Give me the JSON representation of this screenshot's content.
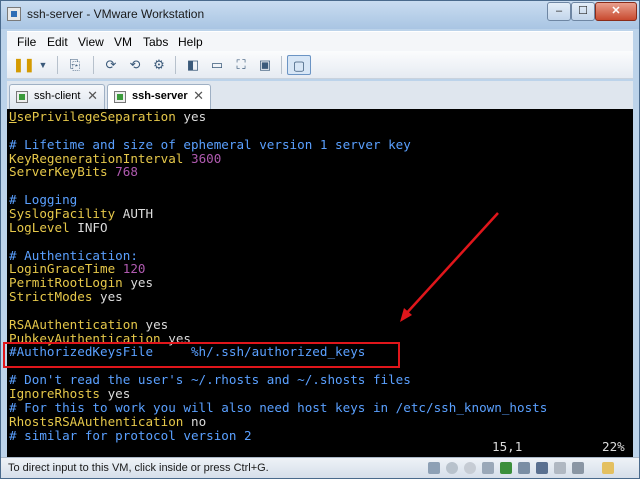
{
  "window": {
    "title": "ssh-server - VMware Workstation",
    "minimize": "–",
    "maximize": "☐",
    "close": "✕"
  },
  "menu": [
    "File",
    "Edit",
    "View",
    "VM",
    "Tabs",
    "Help"
  ],
  "tabs": [
    {
      "label": "ssh-client",
      "active": false
    },
    {
      "label": "ssh-server",
      "active": true
    }
  ],
  "console": {
    "lines": [
      [
        {
          "t": "U",
          "c": "cursor-u"
        },
        {
          "t": "sePrivilegeSeparation ",
          "c": "kw"
        },
        {
          "t": "yes",
          "c": "val"
        }
      ],
      [],
      [
        {
          "t": "# Lifetime and size of ephemeral version 1 server key",
          "c": "cmt"
        }
      ],
      [
        {
          "t": "KeyRegenerationInterval ",
          "c": "kw"
        },
        {
          "t": "3600",
          "c": "num"
        }
      ],
      [
        {
          "t": "ServerKeyBits ",
          "c": "kw"
        },
        {
          "t": "768",
          "c": "num"
        }
      ],
      [],
      [
        {
          "t": "# Logging",
          "c": "cmt"
        }
      ],
      [
        {
          "t": "SyslogFacility ",
          "c": "kw"
        },
        {
          "t": "AUTH",
          "c": "val"
        }
      ],
      [
        {
          "t": "LogLevel ",
          "c": "kw"
        },
        {
          "t": "INFO",
          "c": "val"
        }
      ],
      [],
      [
        {
          "t": "# Authentication:",
          "c": "cmt"
        }
      ],
      [
        {
          "t": "LoginGraceTime ",
          "c": "kw"
        },
        {
          "t": "120",
          "c": "num"
        }
      ],
      [
        {
          "t": "PermitRootLogin ",
          "c": "kw"
        },
        {
          "t": "yes",
          "c": "val"
        }
      ],
      [
        {
          "t": "StrictModes ",
          "c": "kw"
        },
        {
          "t": "yes",
          "c": "val"
        }
      ],
      [],
      [
        {
          "t": "RSAAuthentication ",
          "c": "kw"
        },
        {
          "t": "yes",
          "c": "val"
        }
      ],
      [
        {
          "t": "PubkeyAuthentication ",
          "c": "kw"
        },
        {
          "t": "yes",
          "c": "val"
        }
      ],
      [
        {
          "t": "#AuthorizedKeysFile     %h/.ssh/authorized_keys",
          "c": "cmt"
        }
      ],
      [],
      [
        {
          "t": "# Don't read the user's ~/.rhosts and ~/.shosts files",
          "c": "cmt"
        }
      ],
      [
        {
          "t": "IgnoreRhosts ",
          "c": "kw"
        },
        {
          "t": "yes",
          "c": "val"
        }
      ],
      [
        {
          "t": "# For this to work you will also need host keys in /etc/ssh_known_hosts",
          "c": "cmt"
        }
      ],
      [
        {
          "t": "RhostsRSAAuthentication ",
          "c": "kw"
        },
        {
          "t": "no",
          "c": "val"
        }
      ],
      [
        {
          "t": "# similar for protocol version 2",
          "c": "cmt"
        }
      ]
    ],
    "cursor_position": "15,1",
    "scroll_percent": "22%"
  },
  "status": {
    "text": "To direct input to this VM, click inside or press Ctrl+G."
  },
  "colors": {
    "keyword": "#e6c84a",
    "comment": "#5aa0ff",
    "number": "#b05ab0",
    "annotation": "#e0161b"
  }
}
